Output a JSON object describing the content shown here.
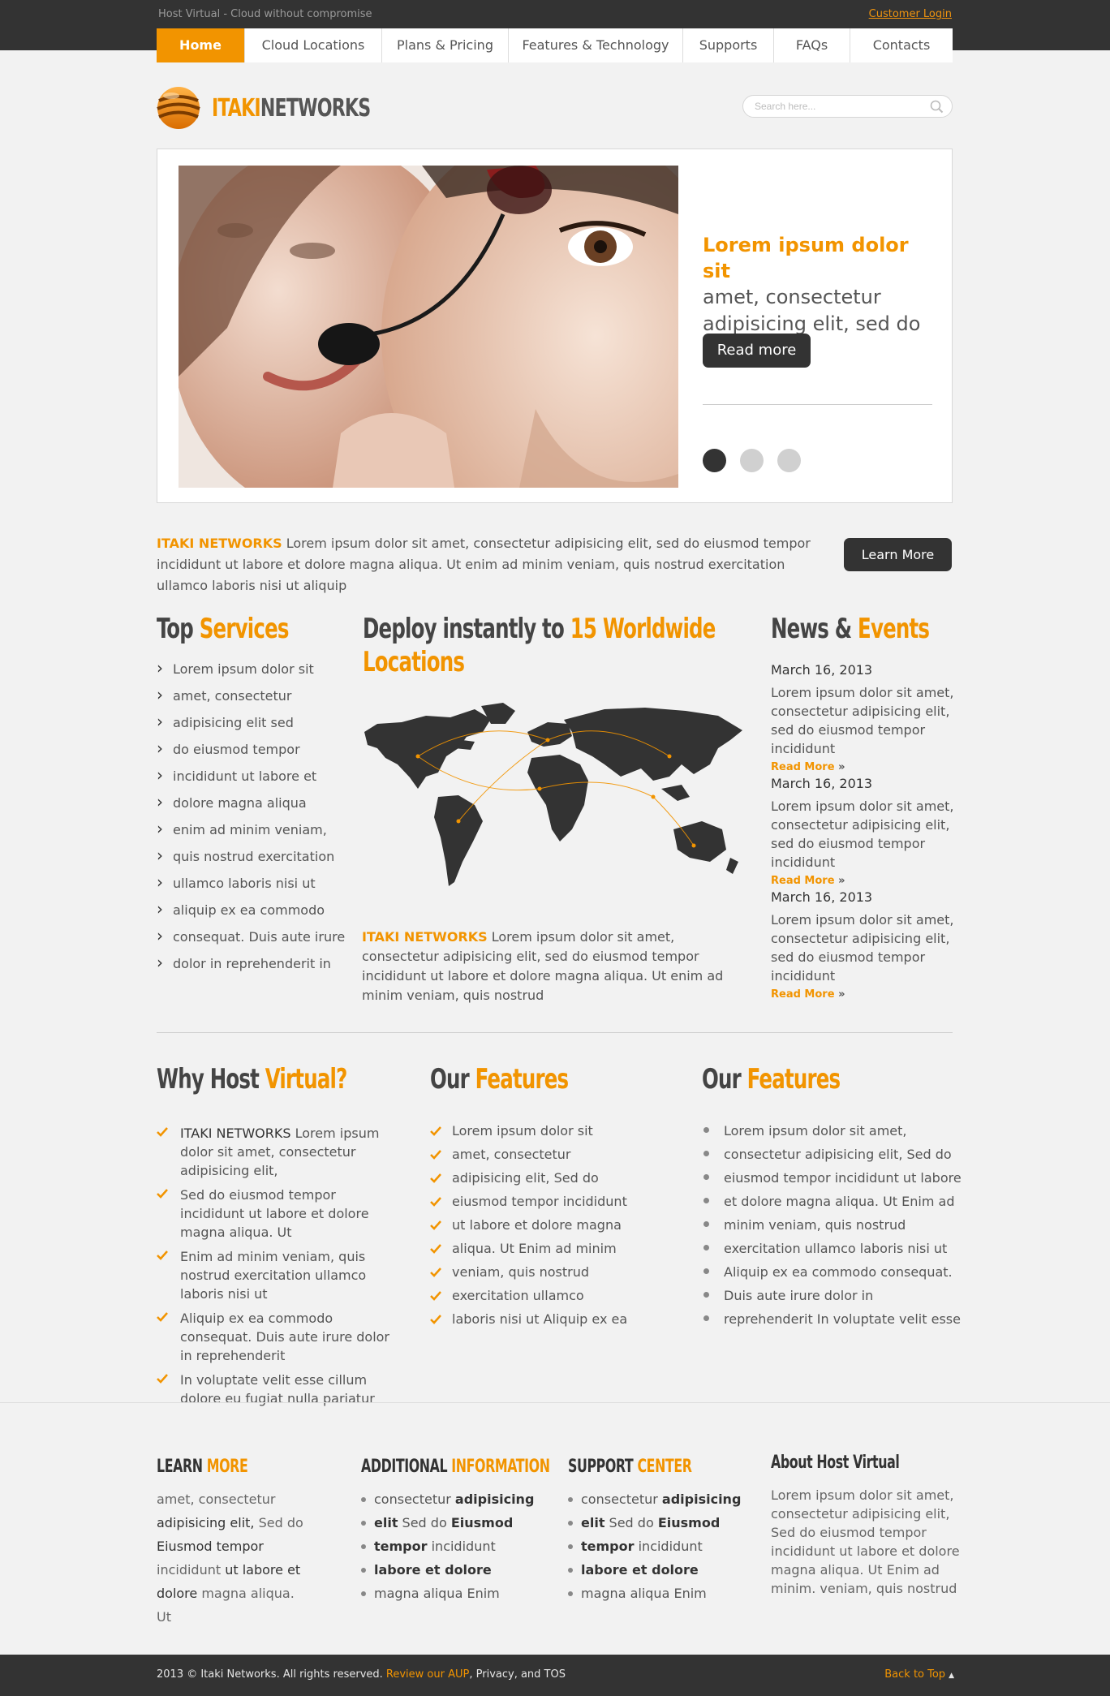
{
  "topbar": {
    "tagline": "Host Virtual - Cloud without compromise",
    "login": "Customer Login"
  },
  "nav": [
    {
      "label": "Home",
      "active": true
    },
    {
      "label": "Cloud Locations"
    },
    {
      "label": "Plans & Pricing"
    },
    {
      "label": "Features & Technology"
    },
    {
      "label": "Supports"
    },
    {
      "label": "FAQs"
    },
    {
      "label": "Contacts"
    }
  ],
  "logo": {
    "part1": "ITAKI",
    "part2": "NETWORKS"
  },
  "search": {
    "placeholder": "Search here..."
  },
  "slider": {
    "caption_highlight": "Lorem ipsum  dolor sit",
    "caption_line1": "amet, consectetur",
    "caption_line2": "adipisicing elit, sed do",
    "button": "Read more",
    "active_slide": 1,
    "slide_count": 3
  },
  "intro": {
    "brand": "ITAKI NETWORKS",
    "text": " Lorem ipsum dolor sit amet, consectetur adipisicing elit, sed do eiusmod tempor incididunt ut labore et dolore magna aliqua. Ut enim ad minim veniam, quis nostrud exercitation ullamco laboris nisi ut aliquip",
    "button": "Learn More"
  },
  "services": {
    "title_a": "Top ",
    "title_b": "Services",
    "items": [
      "Lorem ipsum dolor sit",
      "amet, consectetur",
      "adipisicing elit sed",
      "do eiusmod tempor",
      "incididunt ut labore et",
      "dolore magna aliqua",
      "enim ad minim veniam,",
      "quis nostrud exercitation",
      "ullamco laboris nisi ut",
      "aliquip ex ea commodo",
      "consequat. Duis aute irure",
      "dolor in reprehenderit in"
    ]
  },
  "deploy": {
    "title_a": "Deploy instantly to ",
    "title_b": "15 Worldwide",
    "title_c": "Locations",
    "brand": "ITAKI NETWORKS",
    "text": " Lorem ipsum dolor sit amet, consectetur adipisicing elit, sed do eiusmod tempor incididunt ut labore et dolore magna aliqua. Ut enim ad minim veniam, quis nostrud"
  },
  "news": {
    "title_a": "News & ",
    "title_b": "Events",
    "items": [
      {
        "date": "March 16, 2013",
        "body": "Lorem ipsum dolor sit amet, consectetur adipisicing elit, sed do eiusmod tempor incididunt",
        "more": "Read More",
        "arrow": "»"
      },
      {
        "date": "March 16, 2013",
        "body": "Lorem ipsum dolor sit amet, consectetur adipisicing elit, sed do eiusmod tempor incididunt",
        "more": "Read More",
        "arrow": "»"
      },
      {
        "date": "March 16, 2013",
        "body": "Lorem ipsum dolor sit amet, consectetur adipisicing elit, sed do eiusmod tempor incididunt",
        "more": "Read More",
        "arrow": "»"
      }
    ]
  },
  "why": {
    "title_a": "Why Host ",
    "title_b": "Virtual?",
    "items": [
      {
        "strong": "ITAKI NETWORKS",
        "text": " Lorem ipsum dolor sit amet, consectetur adipisicing elit,"
      },
      {
        "strong": "",
        "text": "Sed do eiusmod tempor incididunt ut labore et dolore magna aliqua. Ut"
      },
      {
        "strong": "",
        "text": "Enim ad minim veniam, quis nostrud exercitation ullamco laboris nisi ut"
      },
      {
        "strong": "",
        "text": "Aliquip ex ea commodo consequat. Duis aute irure dolor in reprehenderit"
      },
      {
        "strong": "",
        "text": "In voluptate velit esse cillum dolore eu fugiat nulla pariatur"
      }
    ]
  },
  "features1": {
    "title_a": "Our ",
    "title_b": "Features",
    "items": [
      "Lorem ipsum dolor sit",
      "amet, consectetur",
      "adipisicing elit, Sed do",
      "eiusmod tempor incididunt",
      "ut labore et dolore magna",
      "aliqua. Ut Enim ad minim",
      "veniam, quis nostrud",
      "exercitation ullamco",
      "laboris nisi ut Aliquip ex ea"
    ]
  },
  "features2": {
    "title_a": "Our ",
    "title_b": "Features",
    "items": [
      "Lorem ipsum dolor sit amet,",
      "consectetur adipisicing elit, Sed do",
      "eiusmod tempor incididunt ut labore",
      "et dolore magna aliqua. Ut Enim ad",
      "minim veniam, quis nostrud",
      "exercitation ullamco laboris nisi ut",
      "Aliquip ex ea commodo consequat.",
      "Duis aute irure dolor in",
      "reprehenderit In voluptate velit esse"
    ]
  },
  "footer": {
    "learn": {
      "title_a": "LEARN ",
      "title_b": "MORE",
      "parts": [
        {
          "t": "amet, consectetur ",
          "b": false
        },
        {
          "t": "adipisicing elit,",
          "b": true
        },
        {
          "t": " Sed do ",
          "b": false
        },
        {
          "t": "Eiusmod tempor",
          "b": true
        },
        {
          "t": " incididunt ",
          "b": false
        },
        {
          "t": "ut labore et dolore",
          "b": true
        },
        {
          "t": " magna aliqua. Ut",
          "b": false
        }
      ]
    },
    "additional": {
      "title_a": "ADDITIONAL ",
      "title_b": "INFORMATION",
      "items": [
        {
          "a": "consectetur ",
          "b": "adipisicing"
        },
        {
          "a": "elit",
          "b": " Sed do ",
          "c": "Eiusmod"
        },
        {
          "a": "tempor",
          "b": " incididunt"
        },
        {
          "a": "labore et dolore",
          "b": ""
        },
        {
          "a": "magna aliqua Enim",
          "b": ""
        }
      ]
    },
    "support": {
      "title_a": "SUPPORT ",
      "title_b": "CENTER",
      "items": [
        {
          "a": "consectetur ",
          "b": "adipisicing"
        },
        {
          "a": "elit",
          "b": " Sed do ",
          "c": "Eiusmod"
        },
        {
          "a": "tempor",
          "b": " incididunt"
        },
        {
          "a": "labore et dolore",
          "b": ""
        },
        {
          "a": "magna aliqua Enim",
          "b": ""
        }
      ]
    },
    "about": {
      "title": "About Host Virtual",
      "text": "Lorem ipsum dolor sit amet, consectetur adipisicing elit, Sed do eiusmod tempor incididunt ut labore et dolore magna aliqua. Ut Enim ad minim. veniam, quis nostrud"
    }
  },
  "bottombar": {
    "copy": "2013 © Itaki Networks. All rights reserved. ",
    "aup": "Review our AUP",
    "rest": ", Privacy, and TOS",
    "totop": "Back to Top",
    "arrow": "▲"
  },
  "colors": {
    "accent": "#f29400",
    "dark": "#333333",
    "text": "#555555",
    "background": "#f2f2f2"
  }
}
